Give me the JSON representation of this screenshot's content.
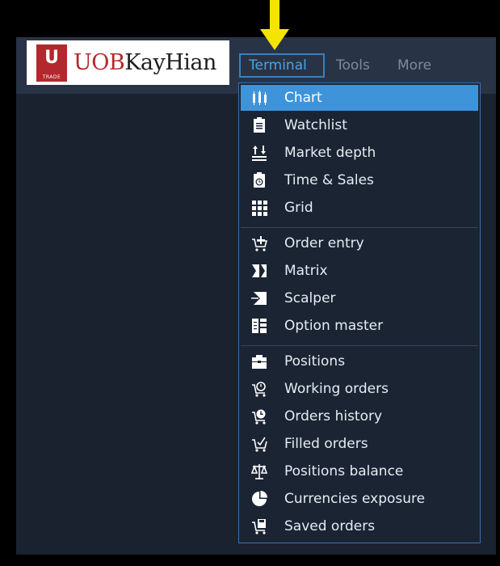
{
  "brand": {
    "logo_mark": "U",
    "logo_caption": "TRADE",
    "name_part1": "UOB",
    "name_part2": "KayHian"
  },
  "nav": {
    "terminal": "Terminal",
    "tools": "Tools",
    "more": "More"
  },
  "menu": {
    "group1": [
      {
        "label": "Chart",
        "icon": "candlestick-chart-icon",
        "selected": true
      },
      {
        "label": "Watchlist",
        "icon": "clipboard-list-icon"
      },
      {
        "label": "Market depth",
        "icon": "market-depth-icon"
      },
      {
        "label": "Time & Sales",
        "icon": "time-sales-icon"
      },
      {
        "label": "Grid",
        "icon": "grid-icon"
      }
    ],
    "group2": [
      {
        "label": "Order entry",
        "icon": "order-entry-icon"
      },
      {
        "label": "Matrix",
        "icon": "matrix-icon"
      },
      {
        "label": "Scalper",
        "icon": "scalper-icon"
      },
      {
        "label": "Option master",
        "icon": "option-master-icon"
      }
    ],
    "group3": [
      {
        "label": "Positions",
        "icon": "briefcase-icon"
      },
      {
        "label": "Working orders",
        "icon": "working-orders-icon"
      },
      {
        "label": "Orders history",
        "icon": "orders-history-icon"
      },
      {
        "label": "Filled orders",
        "icon": "filled-orders-icon"
      },
      {
        "label": "Positions balance",
        "icon": "scales-icon"
      },
      {
        "label": "Currencies exposure",
        "icon": "pie-chart-icon"
      },
      {
        "label": "Saved orders",
        "icon": "saved-orders-icon"
      }
    ]
  },
  "colors": {
    "accent": "#3f94d9",
    "highlight_arrow": "#f5e400",
    "brand_red": "#b3282d"
  }
}
